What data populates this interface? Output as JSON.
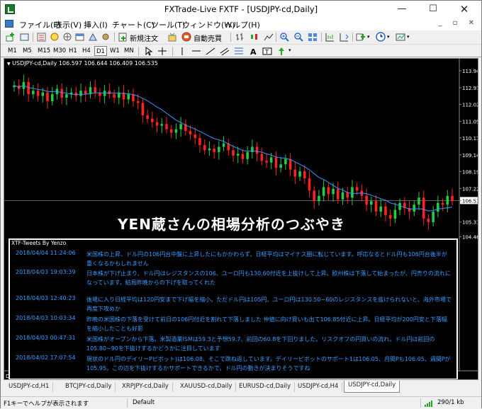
{
  "window": {
    "title": "FXTrade-Live FXTF - [USDJPY-cd,Daily]"
  },
  "menu": [
    "ファイル(F)",
    "表示(V)",
    "挿入(I)",
    "チャート(C)",
    "ツール(T)",
    "ウィンドウ(W)",
    "ヘルプ(H)"
  ],
  "toolbar": {
    "new_order": "新規注文",
    "auto_trade": "自動売買"
  },
  "timeframes": [
    "M1",
    "M5",
    "M15",
    "M30",
    "H1",
    "H4",
    "D1",
    "W1",
    "MN"
  ],
  "active_timeframe": "D1",
  "chart": {
    "symbol_header": "USDJPY-cd,Daily  106.597 106.644 106.409 106.535",
    "overlay_title": "YEN蔵さんの相場分析のつぶやき",
    "current_price": "106.535",
    "price_labels": [
      "113.940",
      "112.970",
      "112.025",
      "111.055",
      "110.110",
      "109.140",
      "108.195",
      "107.225",
      "106.535",
      "105.310",
      "104.465"
    ],
    "date_labels": [
      "15 Dec 2017",
      "27 Dec 2017",
      "9 Jan 2018",
      "19 Jan 2018",
      "31 Jan 2018",
      "12 Feb 2018",
      "22 Feb 2018",
      "6 Mar 2018",
      "16 Mar 2018",
      "28 Mar 2018"
    ],
    "first_date_label": "Dec 2017",
    "bull_color": "#22cc44",
    "bear_color": "#ff2222",
    "ma_color": "#3399ff"
  },
  "tweets": {
    "title": "XTF-Tweets By Yenzo",
    "items": [
      {
        "time": "2018/04/04 11:24:06",
        "text": "米国株の上昇、ドル円の106円台中盤に上昇したにもかかわらず、日経平均はマイナス圏に転じています。呼応なるとドル円も106円台後半が重くなるかもしれません"
      },
      {
        "time": "2018/04/03 19:03:39",
        "text": "日本株が下げ止まり、ドル円はレジスタンスの106、ユーロ円も130.60付近を上抜けして上昇。欧州株は下落して始まったが、円売りの流れになっています。結局昨晩からの下げを取ってくれた"
      },
      {
        "time": "2018/04/03 12:40:23",
        "text": "後場に入り日経平均は120円安まで下げ幅を縮小。ただドル円は105円、ユーロ円は130.50~60のレジスタンスを抜けられないと、海外市場で再度下攻めか"
      },
      {
        "time": "2018/04/03 10:03:34",
        "text": "昨晩の米国株の下落を受けて前日の106円付近を割れて下落しました 仲値に向け買いも出て106.85付近に上昇。日経平均が200円安と下落幅を縮小したことも好影"
      },
      {
        "time": "2018/04/03 00:47:31",
        "text": "米国株がオープンから下落。米製造業ISMは59.3と予想59.7、前回の60.8を下回りました。リスクオフの円買いの流れ。ドル円は前回の105.80~90を下抜けするかどうかに注目しています"
      },
      {
        "time": "2018/04/02 17:07:54",
        "text": "現状のドル円のデイリーPピボット)は106.08、そこで跳ね返しています。デイリーピボットのサポート1は106.05、月間Pも106.05、週間Pが105.95。この辺を下抜けするかサポートできるかで、ドル円の動きが決まりそうですね"
      }
    ]
  },
  "tabs": [
    "USDJPY-cd,H1",
    "BTCJPY-cd,Daily",
    "XRPJPY-cd,Daily",
    "XAUUSD-cd,Daily",
    "EURUSD-cd,Daily",
    "USDJPY-cd,H4",
    "USDJPY-cd,Daily"
  ],
  "active_tab": "USDJPY-cd,Daily",
  "status": {
    "help": "F1キーでヘルプが表示されます",
    "profile": "Default",
    "traffic": "290/1 kb"
  }
}
